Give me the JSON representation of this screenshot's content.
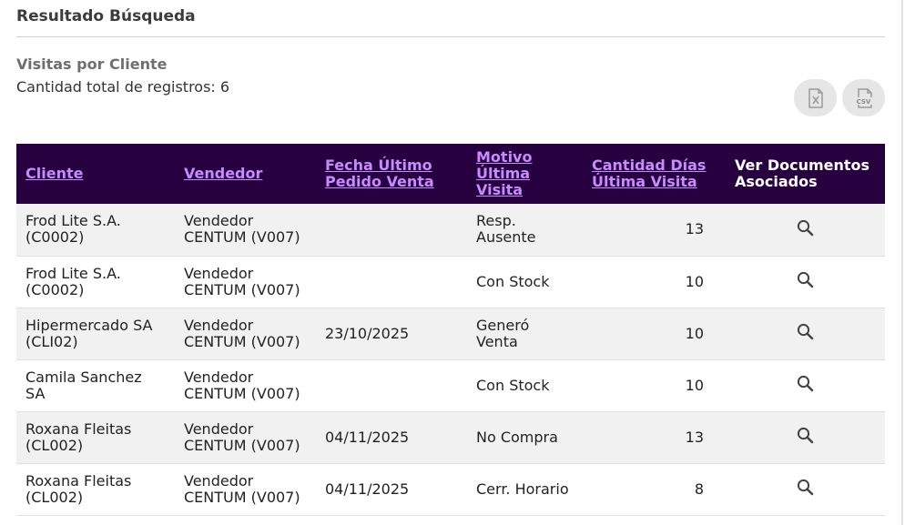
{
  "page": {
    "title": "Resultado Búsqueda",
    "report_name": "Visitas por Cliente",
    "record_count_text": "Cantidad total de registros: 6"
  },
  "export": {
    "excel_icon": "excel-file-icon",
    "csv_icon": "csv-file-icon"
  },
  "table": {
    "header_bg": "#27003f",
    "link_color": "#c78bff",
    "columns": [
      {
        "label": "Cliente"
      },
      {
        "label": "Vendedor"
      },
      {
        "label": "Fecha Último Pedido Venta"
      },
      {
        "label": "Motivo Última Visita"
      },
      {
        "label": "Cantidad Días Última Visita"
      },
      {
        "label": "Ver Documentos Asociados"
      }
    ],
    "rows": [
      {
        "cliente": "Frod Lite S.A. (C0002)",
        "vendedor": "Vendedor CENTUM (V007)",
        "fecha": "",
        "motivo": "Resp. Ausente",
        "dias": "13"
      },
      {
        "cliente": "Frod Lite S.A. (C0002)",
        "vendedor": "Vendedor CENTUM (V007)",
        "fecha": "",
        "motivo": "Con Stock",
        "dias": "10"
      },
      {
        "cliente": "Hipermercado SA (CLI02)",
        "vendedor": "Vendedor CENTUM (V007)",
        "fecha": "23/10/2025",
        "motivo": "Generó Venta",
        "dias": "10"
      },
      {
        "cliente": "Camila Sanchez SA",
        "vendedor": "Vendedor CENTUM (V007)",
        "fecha": "",
        "motivo": "Con Stock",
        "dias": "10"
      },
      {
        "cliente": "Roxana Fleitas (CL002)",
        "vendedor": "Vendedor CENTUM (V007)",
        "fecha": "04/11/2025",
        "motivo": "No Compra",
        "dias": "13"
      },
      {
        "cliente": "Roxana Fleitas (CL002)",
        "vendedor": "Vendedor CENTUM (V007)",
        "fecha": "04/11/2025",
        "motivo": "Cerr. Horario",
        "dias": "8"
      }
    ]
  }
}
